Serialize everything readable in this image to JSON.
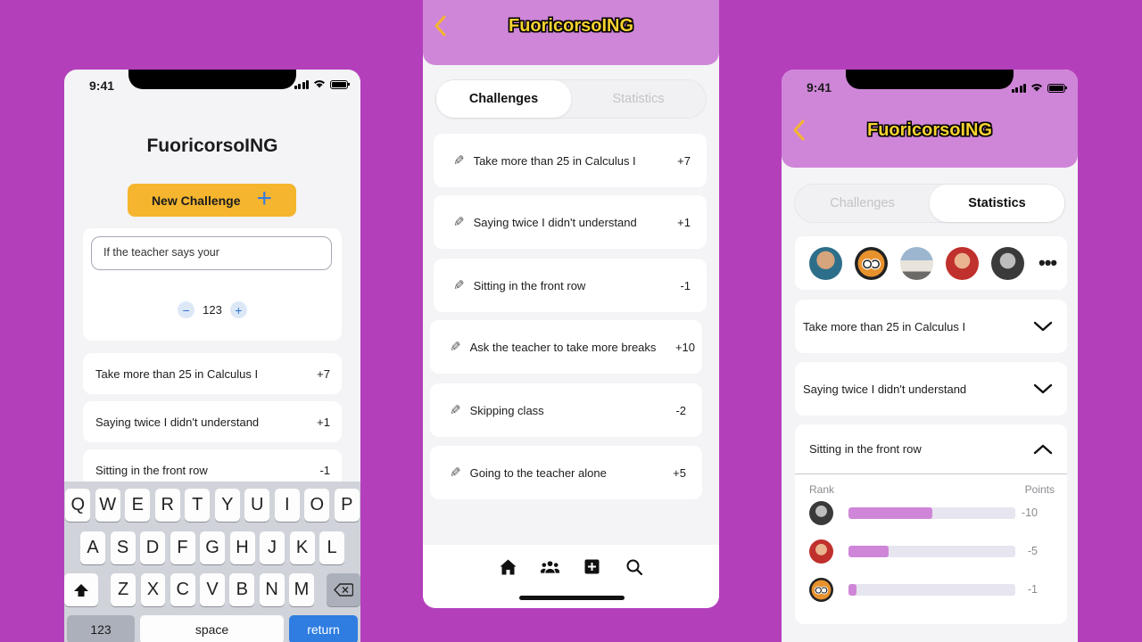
{
  "status": {
    "time": "9:41"
  },
  "app": {
    "title": "FuoricorsoING"
  },
  "screen1": {
    "new_challenge_label": "New Challenge",
    "new_challenge_icon": "+",
    "input_value": "If the teacher says your",
    "stepper": {
      "minus": "−",
      "value": "123",
      "plus": "+"
    },
    "rows": [
      {
        "label": "Take more than 25 in Calculus I",
        "points": "+7"
      },
      {
        "label": "Saying twice I didn't understand",
        "points": "+1"
      },
      {
        "label": "Sitting in the front row",
        "points": "-1"
      }
    ],
    "keyboard": {
      "row1": [
        "Q",
        "W",
        "E",
        "R",
        "T",
        "Y",
        "U",
        "I",
        "O",
        "P"
      ],
      "row2": [
        "A",
        "S",
        "D",
        "F",
        "G",
        "H",
        "J",
        "K",
        "L"
      ],
      "row3": [
        "Z",
        "X",
        "C",
        "V",
        "B",
        "N",
        "M"
      ],
      "numbers": "123",
      "space": "space",
      "return": "return",
      "shift_icon": "shift-icon",
      "delete_icon": "delete-icon"
    }
  },
  "screen2": {
    "back_icon": "chevron-left-icon",
    "tabs": {
      "challenges": "Challenges",
      "statistics": "Statistics",
      "active": "challenges"
    },
    "rows": [
      {
        "label": "Take more than 25 in Calculus I",
        "points": "+7"
      },
      {
        "label": "Saying twice I didn't understand",
        "points": "+1"
      },
      {
        "label": "Sitting in the front row",
        "points": "-1"
      },
      {
        "label": "Ask the teacher to take more breaks",
        "points": "+10"
      },
      {
        "label": "Skipping class",
        "points": "-2"
      },
      {
        "label": "Going to the teacher alone",
        "points": "+5"
      }
    ],
    "tabbar": [
      "home-icon",
      "group-icon",
      "add-square-icon",
      "search-icon"
    ]
  },
  "screen3": {
    "time": "9:41",
    "tabs": {
      "challenges": "Challenges",
      "statistics": "Statistics",
      "active": "statistics"
    },
    "more_icon": "•••",
    "accordions": [
      {
        "label": "Take more than 25 in Calculus I",
        "state": "collapsed"
      },
      {
        "label": "Saying twice I didn't understand",
        "state": "collapsed"
      }
    ],
    "expanded": {
      "label": "Sitting in the front row",
      "rank_header": "Rank",
      "points_header": "Points",
      "leaders": [
        {
          "points": "-10",
          "fill": 0.5
        },
        {
          "points": "-5",
          "fill": 0.24
        },
        {
          "points": "-1",
          "fill": 0.05
        }
      ]
    }
  },
  "colors": {
    "background": "#b43fbb",
    "header": "#cf86d8",
    "accent": "#f5b52e",
    "brand_text": "#f7d230",
    "bar_fill": "#cf86d8",
    "bar_track": "#e7e5f0"
  }
}
